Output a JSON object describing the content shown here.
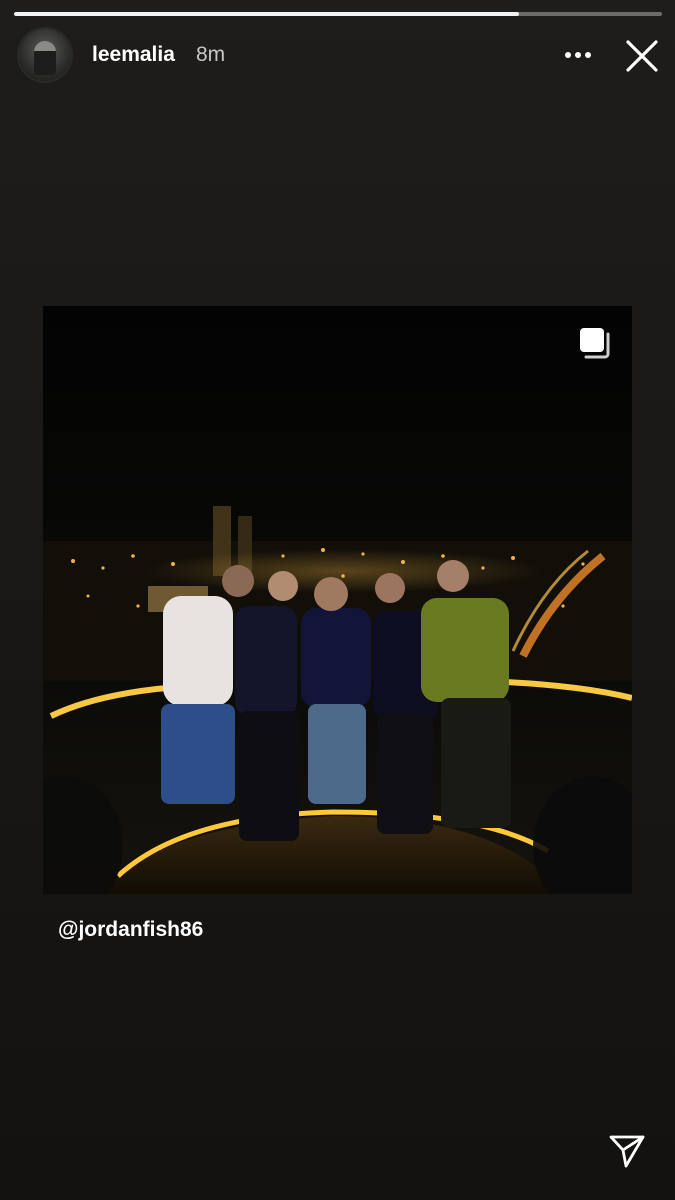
{
  "story": {
    "progress": 0.78,
    "user": {
      "username": "leemalia",
      "time": "8m"
    },
    "icons": {
      "avatar": "user-avatar",
      "more": "more-horizontal-icon",
      "close": "close-icon",
      "carousel": "multiple-photos-icon",
      "send": "send-icon"
    }
  },
  "post": {
    "mention": "@jordanfish86"
  },
  "colors": {
    "background": "#1b1b1b",
    "text": "#ffffff",
    "progress_fill": "#f2f2f2",
    "city_lights": "#f2a935",
    "railing_glow": "#f7c842"
  }
}
